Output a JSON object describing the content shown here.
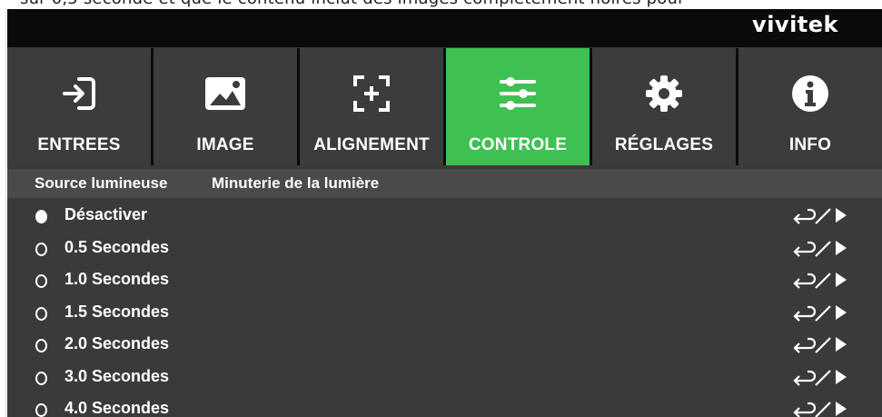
{
  "document": {
    "top_text": "sur 0,5 seconde et que le contenu inclut des images complètement noires pour"
  },
  "brand": "vivitek",
  "tabs": [
    {
      "label": "ENTREES",
      "icon": "input-icon",
      "active": false
    },
    {
      "label": "IMAGE",
      "icon": "image-icon",
      "active": false
    },
    {
      "label": "ALIGNEMENT",
      "icon": "alignment-icon",
      "active": false
    },
    {
      "label": "CONTROLE",
      "icon": "sliders-icon",
      "active": true
    },
    {
      "label": "RÉGLAGES",
      "icon": "gear-icon",
      "active": false
    },
    {
      "label": "INFO",
      "icon": "info-icon",
      "active": false
    }
  ],
  "breadcrumb": {
    "section": "Source lumineuse",
    "page": "Minuterie de la lumière"
  },
  "options": [
    {
      "label": "Désactiver",
      "selected": true
    },
    {
      "label": "0.5 Secondes",
      "selected": false
    },
    {
      "label": "1.0 Secondes",
      "selected": false
    },
    {
      "label": "1.5 Secondes",
      "selected": false
    },
    {
      "label": "2.0 Secondes",
      "selected": false
    },
    {
      "label": "3.0 Secondes",
      "selected": false
    },
    {
      "label": "4.0 Secondes",
      "selected": false
    }
  ],
  "action_icon": "enter-or-right-arrow-icon",
  "colors": {
    "active_tab": "#3ec152",
    "osd_background": "#3a3a3a",
    "tab_background": "#3c3c3c",
    "topbar": "#0b0b0b"
  }
}
